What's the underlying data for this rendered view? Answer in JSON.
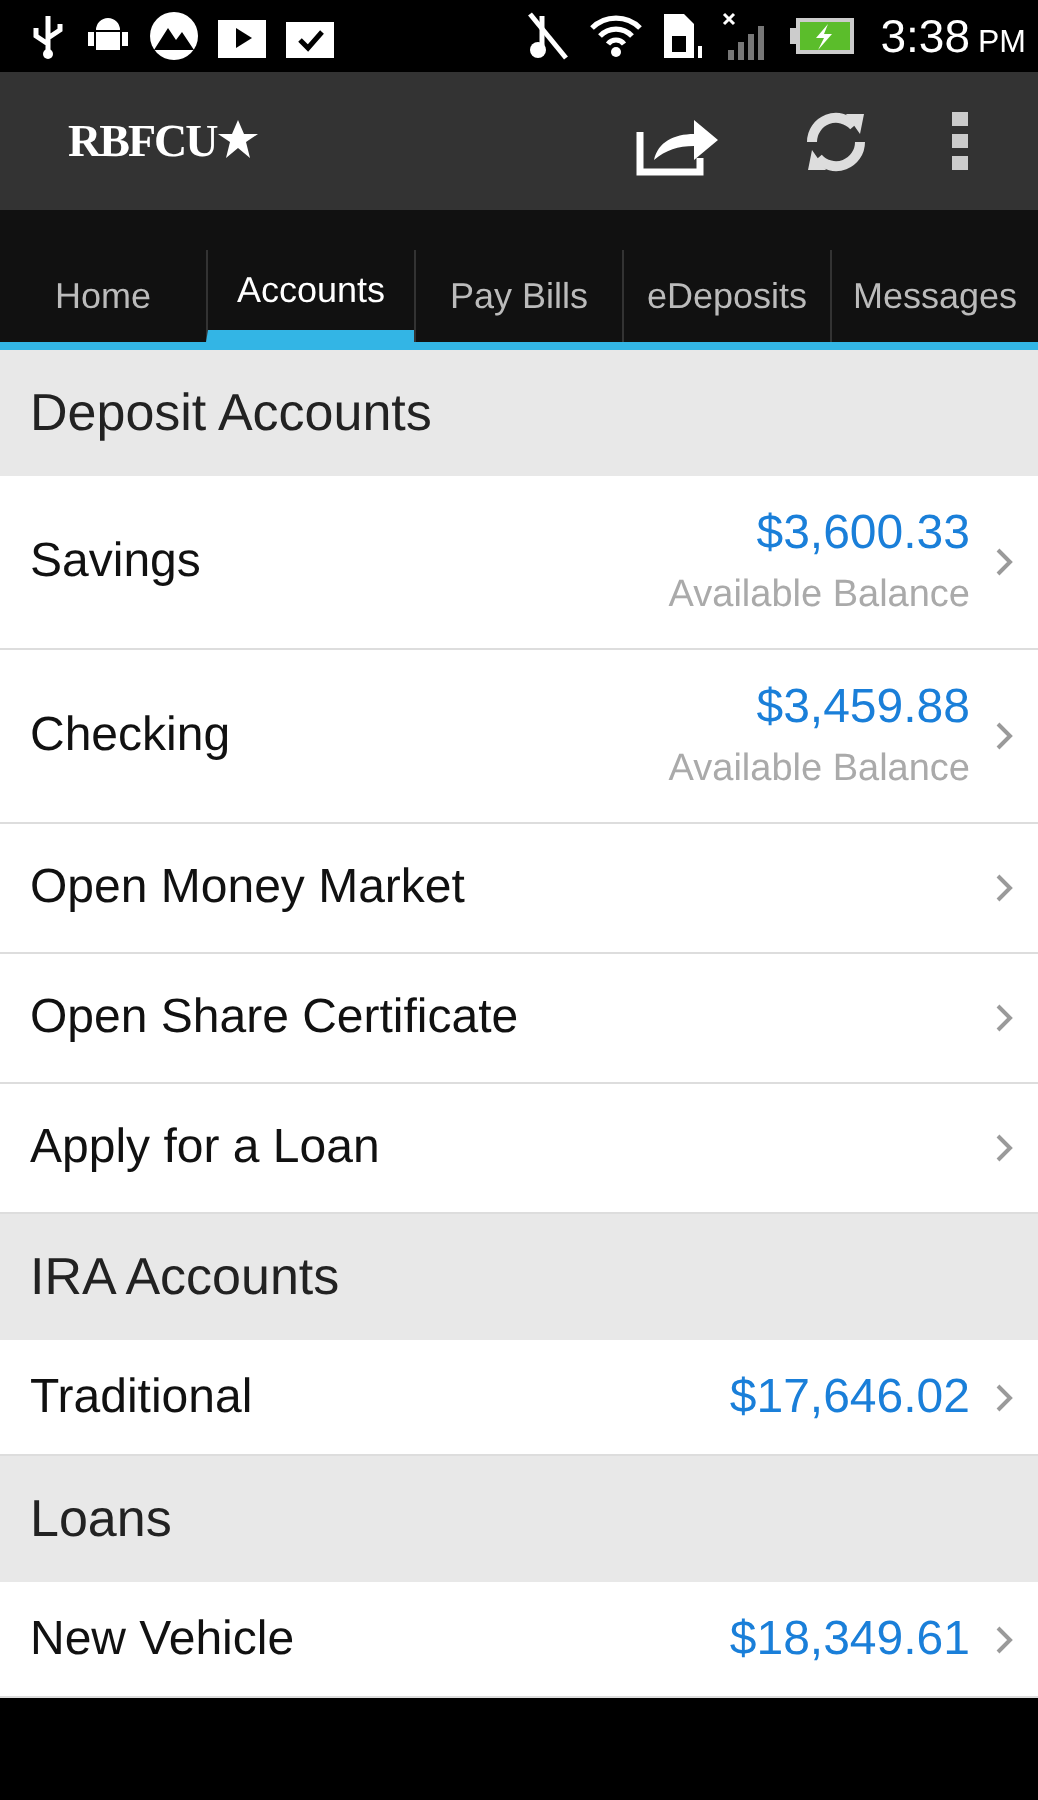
{
  "status_bar": {
    "time": "3:38",
    "meridiem": "PM"
  },
  "app_bar": {
    "logo": "RBFCU"
  },
  "tabs": [
    {
      "label": "Home",
      "selected": false
    },
    {
      "label": "Accounts",
      "selected": true
    },
    {
      "label": "Pay Bills",
      "selected": false
    },
    {
      "label": "eDeposits",
      "selected": false
    },
    {
      "label": "Messages",
      "selected": false
    }
  ],
  "sections": [
    {
      "title": "Deposit Accounts",
      "rows": [
        {
          "kind": "balance",
          "name": "Savings",
          "amount": "$3,600.33",
          "note": "Available Balance"
        },
        {
          "kind": "balance",
          "name": "Checking",
          "amount": "$3,459.88",
          "note": "Available Balance"
        },
        {
          "kind": "link",
          "name": "Open Money Market"
        },
        {
          "kind": "link",
          "name": "Open Share Certificate"
        },
        {
          "kind": "link",
          "name": "Apply for a Loan"
        }
      ]
    },
    {
      "title": "IRA Accounts",
      "rows": [
        {
          "kind": "amount",
          "name": "Traditional",
          "amount": "$17,646.02"
        }
      ]
    },
    {
      "title": "Loans",
      "rows": [
        {
          "kind": "amount",
          "name": "New Vehicle",
          "amount": "$18,349.61"
        }
      ]
    }
  ]
}
